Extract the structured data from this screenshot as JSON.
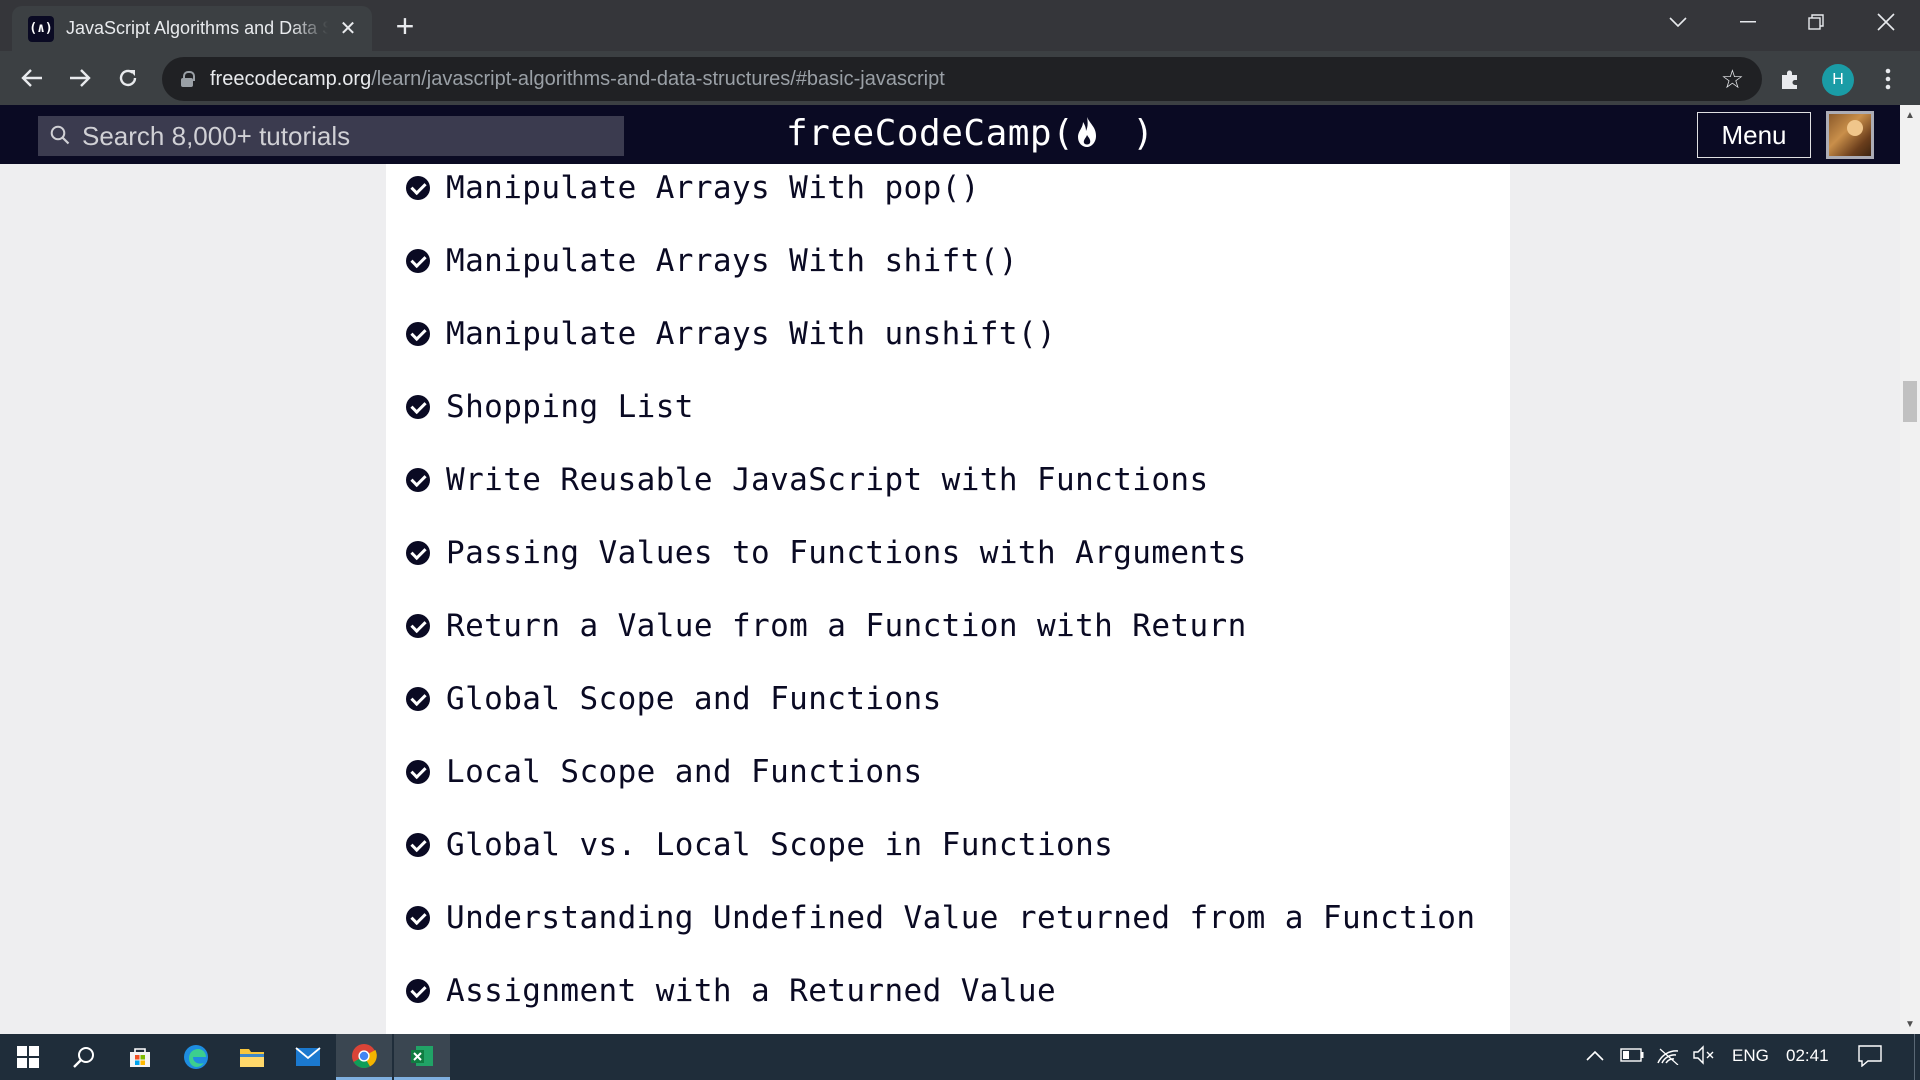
{
  "browser": {
    "tab_title": "JavaScript Algorithms and Data Structures",
    "tab_favicon": "(∧)",
    "new_tab_label": "+",
    "url_host": "freecodecamp.org",
    "url_path": "/learn/javascript-algorithms-and-data-structures/#basic-javascript",
    "profile_initial": "H"
  },
  "site": {
    "search_placeholder": "Search 8,000+ tutorials",
    "brand": "freeCodeCamp",
    "brand_paren_open": "(",
    "brand_paren_close": ")",
    "menu_label": "Menu"
  },
  "lessons": [
    {
      "title": "Manipulate Arrays With pop()",
      "completed": true
    },
    {
      "title": "Manipulate Arrays With shift()",
      "completed": true
    },
    {
      "title": "Manipulate Arrays With unshift()",
      "completed": true
    },
    {
      "title": "Shopping List",
      "completed": true
    },
    {
      "title": "Write Reusable JavaScript with Functions",
      "completed": true
    },
    {
      "title": "Passing Values to Functions with Arguments",
      "completed": true
    },
    {
      "title": "Return a Value from a Function with Return",
      "completed": true
    },
    {
      "title": "Global Scope and Functions",
      "completed": true
    },
    {
      "title": "Local Scope and Functions",
      "completed": true
    },
    {
      "title": "Global vs. Local Scope in Functions",
      "completed": true
    },
    {
      "title": "Understanding Undefined Value returned from a Function",
      "completed": true
    },
    {
      "title": "Assignment with a Returned Value",
      "completed": true
    }
  ],
  "taskbar": {
    "language": "ENG",
    "time": "02:41"
  },
  "colors": {
    "fcc_dark": "#0a0a23",
    "fcc_search_bg": "#3b3b4f",
    "chrome_tabstrip": "#35363a",
    "chrome_toolbar": "#3c4043",
    "taskbar": "#1f2d3a"
  }
}
